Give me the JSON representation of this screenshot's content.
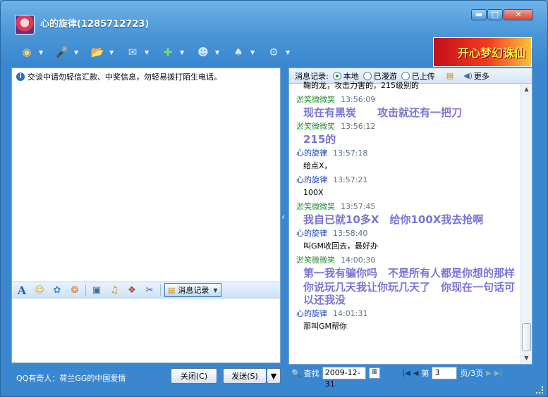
{
  "window": {
    "title": "心的旋律(1285712723)",
    "buttons": {
      "min": "▬",
      "max": "□",
      "close": "✕"
    }
  },
  "toolbar": {
    "items": [
      {
        "icon": "webcam-icon",
        "glyph": "◉",
        "color": "#f5d36a"
      },
      {
        "icon": "microphone-icon",
        "glyph": "🎤",
        "color": "#cfe6fb"
      },
      {
        "icon": "send-file-icon",
        "glyph": "📂",
        "color": "#f6c15a"
      },
      {
        "icon": "message-box-icon",
        "glyph": "✉",
        "color": "#cfe6fb"
      },
      {
        "icon": "add-contact-icon",
        "glyph": "✚",
        "color": "#7fd67a"
      },
      {
        "icon": "group-icon",
        "glyph": "☻",
        "color": "#cfe6fb"
      },
      {
        "icon": "game-icon",
        "glyph": "♠",
        "color": "#cfe6fb"
      },
      {
        "icon": "settings-icon",
        "glyph": "⚙",
        "color": "#cfe6fb"
      }
    ]
  },
  "banner": {
    "text": "开心梦幻诛仙"
  },
  "chat": {
    "notice": "交谈中请勿轻信汇款、中奖信息，勿轻易拨打陌生电话。"
  },
  "format_bar": {
    "font_label": "A",
    "history_label": "消息记录"
  },
  "peer_status": "QQ有奇人：荷兰GG的中国爱情",
  "buttons": {
    "close": "关闭(C)",
    "send": "发送(S)",
    "send_dropdown": "▼"
  },
  "history": {
    "label": "消息记录:",
    "options": [
      {
        "label": "本地",
        "selected": true
      },
      {
        "label": "已漫游",
        "selected": false
      },
      {
        "label": "已上传",
        "selected": false
      }
    ],
    "more": "更多",
    "messages": [
      {
        "sender": "",
        "time": "",
        "text": "鞠的龙，攻击力害的，215级别的",
        "big": false,
        "who": "me"
      },
      {
        "sender": "淤笑微微笑",
        "time": "13:56:09",
        "text": "现在有黑炭　　攻击就还有一把刀",
        "big": true,
        "who": "them"
      },
      {
        "sender": "淤笑微微笑",
        "time": "13:56:12",
        "text": "215的",
        "big": true,
        "who": "them"
      },
      {
        "sender": "心的旋律",
        "time": "13:57:18",
        "text": "给点X，",
        "big": false,
        "who": "me"
      },
      {
        "sender": "心的旋律",
        "time": "13:57:21",
        "text": "100X",
        "big": false,
        "who": "me"
      },
      {
        "sender": "淤笑微微笑",
        "time": "13:57:45",
        "text": "我自已就10多X　给你100X我去抢啊",
        "big": true,
        "who": "them"
      },
      {
        "sender": "心的旋律",
        "time": "13:58:40",
        "text": "叫GM收回去，最好办",
        "big": false,
        "who": "me"
      },
      {
        "sender": "淤笑微微笑",
        "time": "14:00:30",
        "text": "第一我有骗你吗　不是所有人都是你想的那样",
        "big": true,
        "who": "them"
      },
      {
        "sender": "",
        "time": "",
        "text": "你说玩几天我让你玩几天了　你现在一句话可以还我没",
        "big": true,
        "who": "them"
      },
      {
        "sender": "心的旋律",
        "time": "14:01:31",
        "text": "那叫GM帮你",
        "big": false,
        "who": "me"
      }
    ]
  },
  "nav": {
    "search": "查找",
    "date": "2009-12-31",
    "page_prefix": "第",
    "page": "3",
    "page_suffix": "页/3页"
  }
}
